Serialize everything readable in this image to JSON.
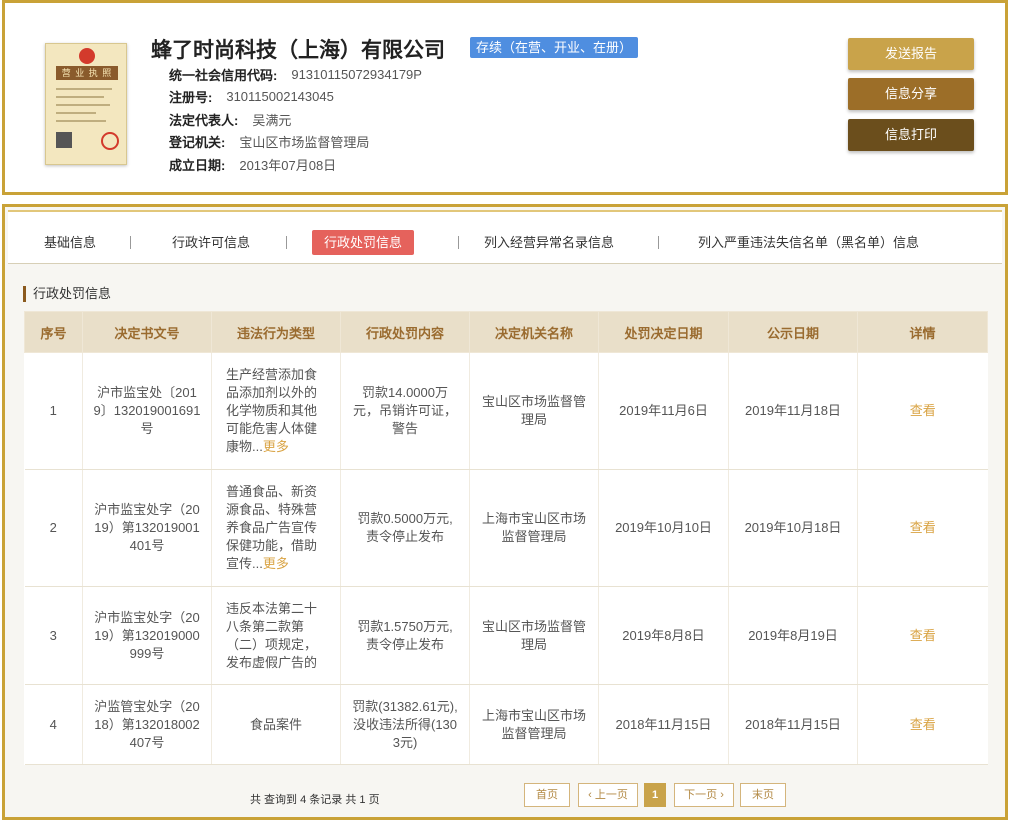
{
  "company": {
    "name": "蜂了时尚科技（上海）有限公司",
    "status": "存续（在营、开业、在册）",
    "license_image_title": "营 业 执 照"
  },
  "info": [
    {
      "label": "统一社会信用代码:",
      "value": "91310115072934179P"
    },
    {
      "label": "注册号:",
      "value": "310115002143045"
    },
    {
      "label": "法定代表人:",
      "value": "吴满元"
    },
    {
      "label": "登记机关:",
      "value": "宝山区市场监督管理局"
    },
    {
      "label": "成立日期:",
      "value": "2013年07月08日"
    }
  ],
  "buttons": {
    "report": "发送报告",
    "share": "信息分享",
    "print": "信息打印"
  },
  "tabs": [
    {
      "label": "基础信息",
      "active": false
    },
    {
      "label": "行政许可信息",
      "active": false
    },
    {
      "label": "行政处罚信息",
      "active": true
    },
    {
      "label": "列入经营异常名录信息",
      "active": false
    },
    {
      "label": "列入严重违法失信名单（黑名单）信息",
      "active": false
    }
  ],
  "section_title": "行政处罚信息",
  "table": {
    "headers": [
      "序号",
      "决定书文号",
      "违法行为类型",
      "行政处罚内容",
      "决定机关名称",
      "处罚决定日期",
      "公示日期",
      "详情"
    ],
    "rows": [
      {
        "no": "1",
        "doc_no": "沪市监宝处〔2019〕132019001691号",
        "violation": "生产经营添加食品添加剂以外的化学物质和其他可能危害人体健康物...",
        "more": "更多",
        "content": "罚款14.0000万元，吊销许可证，警告",
        "authority": "宝山区市场监督管理局",
        "decision_date": "2019年11月6日",
        "publish_date": "2019年11月18日",
        "detail": "查看"
      },
      {
        "no": "2",
        "doc_no": "沪市监宝处字（2019）第132019001401号",
        "violation": "普通食品、新资源食品、特殊营养食品广告宣传保健功能，借助宣传...",
        "more": "更多",
        "content": "罚款0.5000万元,责令停止发布",
        "authority": "上海市宝山区市场监督管理局",
        "decision_date": "2019年10月10日",
        "publish_date": "2019年10月18日",
        "detail": "查看"
      },
      {
        "no": "3",
        "doc_no": "沪市监宝处字（2019）第132019000999号",
        "violation": "违反本法第二十八条第二款第（二）项规定，发布虚假广告的",
        "more": "",
        "content": "罚款1.5750万元,责令停止发布",
        "authority": "宝山区市场监督管理局",
        "decision_date": "2019年8月8日",
        "publish_date": "2019年8月19日",
        "detail": "查看"
      },
      {
        "no": "4",
        "doc_no": "沪监管宝处字（2018）第132018002407号",
        "violation": "食品案件",
        "more": "",
        "content": "罚款(31382.61元),没收违法所得(1303元)",
        "authority": "上海市宝山区市场监督管理局",
        "decision_date": "2018年11月15日",
        "publish_date": "2018年11月15日",
        "detail": "查看"
      }
    ]
  },
  "pagination": {
    "summary": "共 查询到 4 条记录 共 1 页",
    "first": "首页",
    "prev": "上一页",
    "current": "1",
    "next": "下一页",
    "last": "末页",
    "prev_icon": "‹",
    "next_icon": "›"
  }
}
